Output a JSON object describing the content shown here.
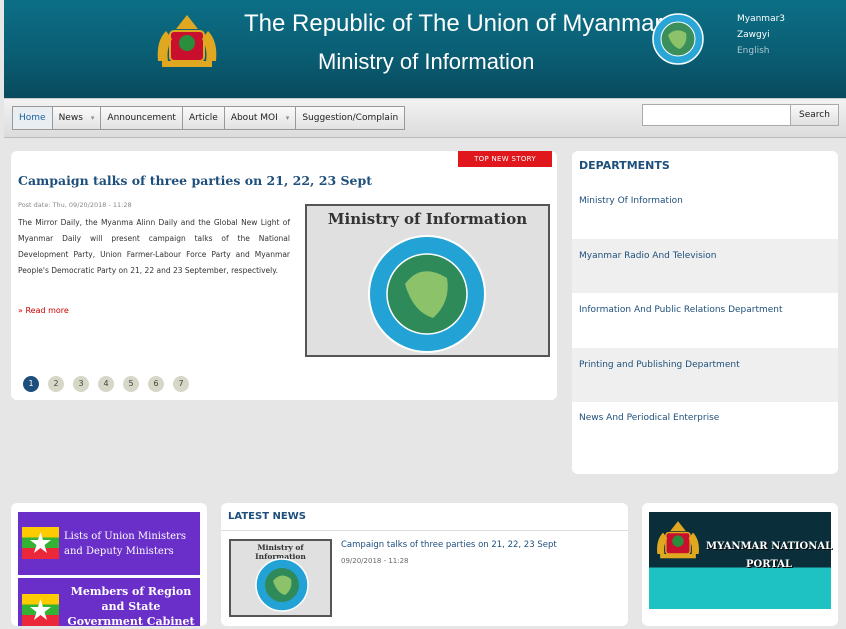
{
  "header": {
    "title_line1": "The Republic of The Union of Myanmar",
    "title_line2": "Ministry of Information",
    "languages": [
      "Myanmar3",
      "Zawgyi",
      "English"
    ],
    "colors": {
      "background": "#0a5e74",
      "active_lang": "#ffffff",
      "inactive_lang": "#a9c7d0"
    }
  },
  "nav": {
    "items": [
      "Home",
      "News",
      "Announcement",
      "Article",
      "About MOI",
      "Suggestion/Complain"
    ],
    "search_placeholder": "",
    "search_button": "Search"
  },
  "top_story": {
    "badge": "TOP NEW STORY",
    "title": "Campaign talks of three parties on 21, 22, 23 Sept",
    "post_date": "Post date: Thu, 09/20/2018 - 11:28",
    "body": "The Mirror Daily, the Myanma Alinn Daily and the Global New Light of Myanmar Daily will present campaign talks of the National Development Party, Union Farmer-Labour Force Party and Myanmar People's Democratic Party on 21, 22 and 23 September, respectively.",
    "read_more": "Read more",
    "image_title": "Ministry of Information",
    "pages": [
      "1",
      "2",
      "3",
      "4",
      "5",
      "6",
      "7"
    ],
    "active_page": "1"
  },
  "departments": {
    "title": "DEPARTMENTS",
    "items": [
      "Ministry Of Information",
      "Myanmar Radio And Television",
      "Information And Public Relations Department",
      "Printing and Publishing Department",
      "News And Periodical Enterprise"
    ]
  },
  "ministers": {
    "items": [
      "Lists of Union Ministers and Deputy Ministers",
      "Members of Region and State Government Cabinet"
    ]
  },
  "latest_news": {
    "title": "LATEST NEWS",
    "items": [
      {
        "thumb_title": "Ministry of Information",
        "title": "Campaign talks of three parties on 21, 22, 23 Sept",
        "date": "09/20/2018 - 11:28"
      }
    ]
  },
  "portal": {
    "label1": "MYANMAR NATIONAL",
    "label2": "PORTAL"
  }
}
